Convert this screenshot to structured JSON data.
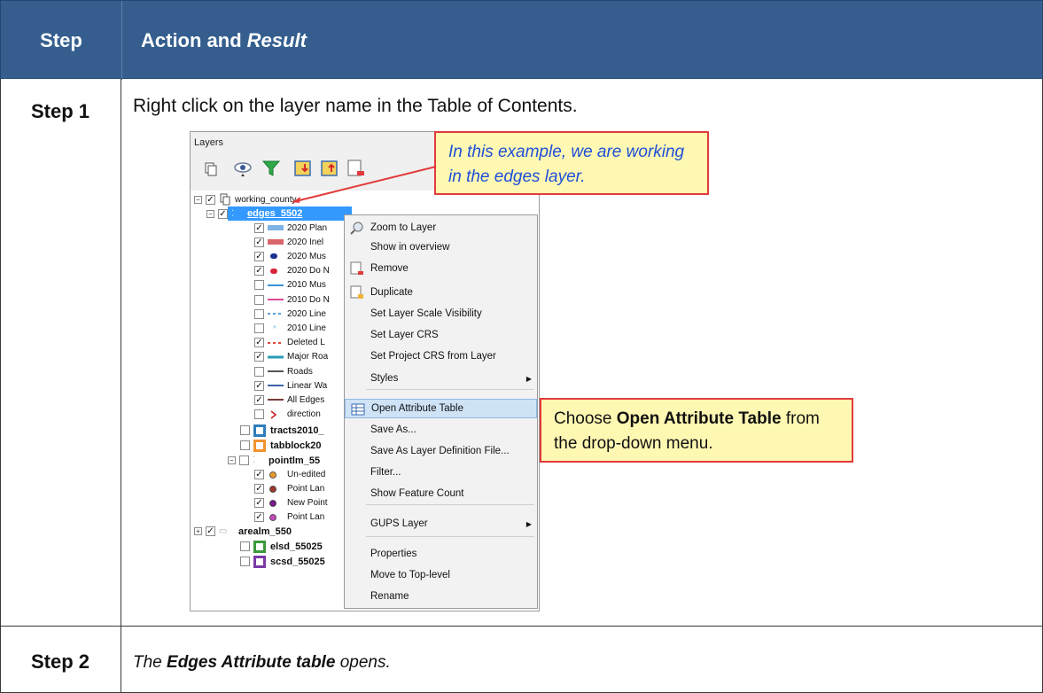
{
  "header": {
    "col_step": "Step",
    "col_action": "Action and",
    "col_action_italic": "Result"
  },
  "step1": {
    "label": "Step 1",
    "text": "Right click on the layer name in the Table of Contents."
  },
  "step2": {
    "label": "Step 2",
    "text_prefix": "The",
    "text_bold": "Edges Attribute table",
    "text_suffix": "opens."
  },
  "panel": {
    "title": "Layers",
    "group": "working_county",
    "selected_layer": "edges_5502",
    "layers": [
      {
        "label": "2020 Plan",
        "checked": true,
        "color": "#7fb2e5",
        "kind": "bar"
      },
      {
        "label": "2020 Inel",
        "checked": true,
        "color": "#d9666b",
        "kind": "bar"
      },
      {
        "label": "2020 Mus",
        "checked": true,
        "color": "#1a2f8f",
        "kind": "dot"
      },
      {
        "label": "2020 Do N",
        "checked": true,
        "color": "#d6243a",
        "kind": "dot"
      },
      {
        "label": "2010 Mus",
        "checked": false,
        "color": "#3a93d8",
        "kind": "line"
      },
      {
        "label": "2010 Do N",
        "checked": false,
        "color": "#e04a9a",
        "kind": "line"
      },
      {
        "label": "2020 Line",
        "checked": false,
        "color": "#5a9ee0",
        "kind": "dash"
      },
      {
        "label": "2010 Line",
        "checked": false,
        "color": "#8ac4ef",
        "kind": "star"
      },
      {
        "label": "Deleted L",
        "checked": true,
        "color": "#e2463a",
        "kind": "dash"
      },
      {
        "label": "Major Roa",
        "checked": true,
        "color": "#2a9bb5",
        "kind": "thick"
      },
      {
        "label": "Roads",
        "checked": false,
        "color": "#555555",
        "kind": "line"
      },
      {
        "label": "Linear Wa",
        "checked": true,
        "color": "#3a62a8",
        "kind": "line"
      },
      {
        "label": "All Edges",
        "checked": true,
        "color": "#7a3a3a",
        "kind": "line"
      },
      {
        "label": "direction",
        "checked": false,
        "color": "#cc2222",
        "kind": "chev"
      }
    ],
    "other_layers": [
      {
        "label": "tracts2010_",
        "color": "#2e7bbd"
      },
      {
        "label": "tabblock20",
        "color": "#f0922e"
      }
    ],
    "point_group": "pointlm_55",
    "point_layers": [
      {
        "label": "Un-edited",
        "color": "#e69a2e"
      },
      {
        "label": "Point Lan",
        "color": "#9b3a2a"
      },
      {
        "label": "New Point",
        "color": "#7a1a8a"
      },
      {
        "label": "Point Lan",
        "color": "#c04ab8"
      }
    ],
    "area_group": "arealm_550",
    "bottom_layers": [
      {
        "label": "elsd_55025",
        "color": "#3a9a3a"
      },
      {
        "label": "scsd_55025",
        "color": "#7a3aa8"
      }
    ]
  },
  "menu": {
    "items": [
      "Zoom to Layer",
      "Show in overview",
      "Remove",
      "Duplicate",
      "Set Layer Scale Visibility",
      "Set Layer CRS",
      "Set Project CRS from Layer",
      "Styles",
      "Open Attribute Table",
      "Save As...",
      "Save As Layer Definition File...",
      "Filter...",
      "Show Feature Count",
      "GUPS Layer",
      "Properties",
      "Move to Top-level",
      "Rename"
    ]
  },
  "callouts": {
    "top": "In this example, we are working in the edges layer.",
    "right_prefix": "Choose",
    "right_bold": "Open Attribute Table",
    "right_suffix": "from the drop-down menu."
  }
}
